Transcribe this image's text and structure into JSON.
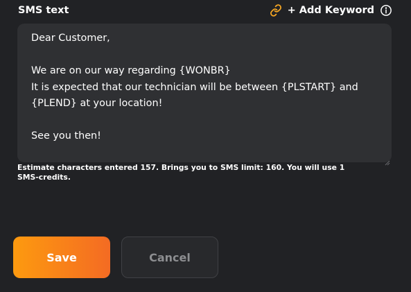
{
  "sms": {
    "label": "SMS text",
    "add_keyword_label": "+ Add Keyword",
    "message": "Dear Customer,\n\nWe are on our way regarding {WONBR}\nIt is expected that our technician will be between {PLSTART} and\n{PLEND} at your location!\n\nSee you then!",
    "estimate": "Estimate characters entered 157. Brings you to SMS limit: 160. You will use 1 SMS-credits."
  },
  "actions": {
    "save_label": "Save",
    "cancel_label": "Cancel"
  },
  "icons": {
    "link": "link-icon",
    "info": "info-icon"
  },
  "colors": {
    "background": "#212225",
    "textarea_bg": "#2f3033",
    "accent_start": "#fd9a0f",
    "accent_end": "#f46b23",
    "link_icon": "#f5a623",
    "cancel_text": "#8d8e91"
  }
}
